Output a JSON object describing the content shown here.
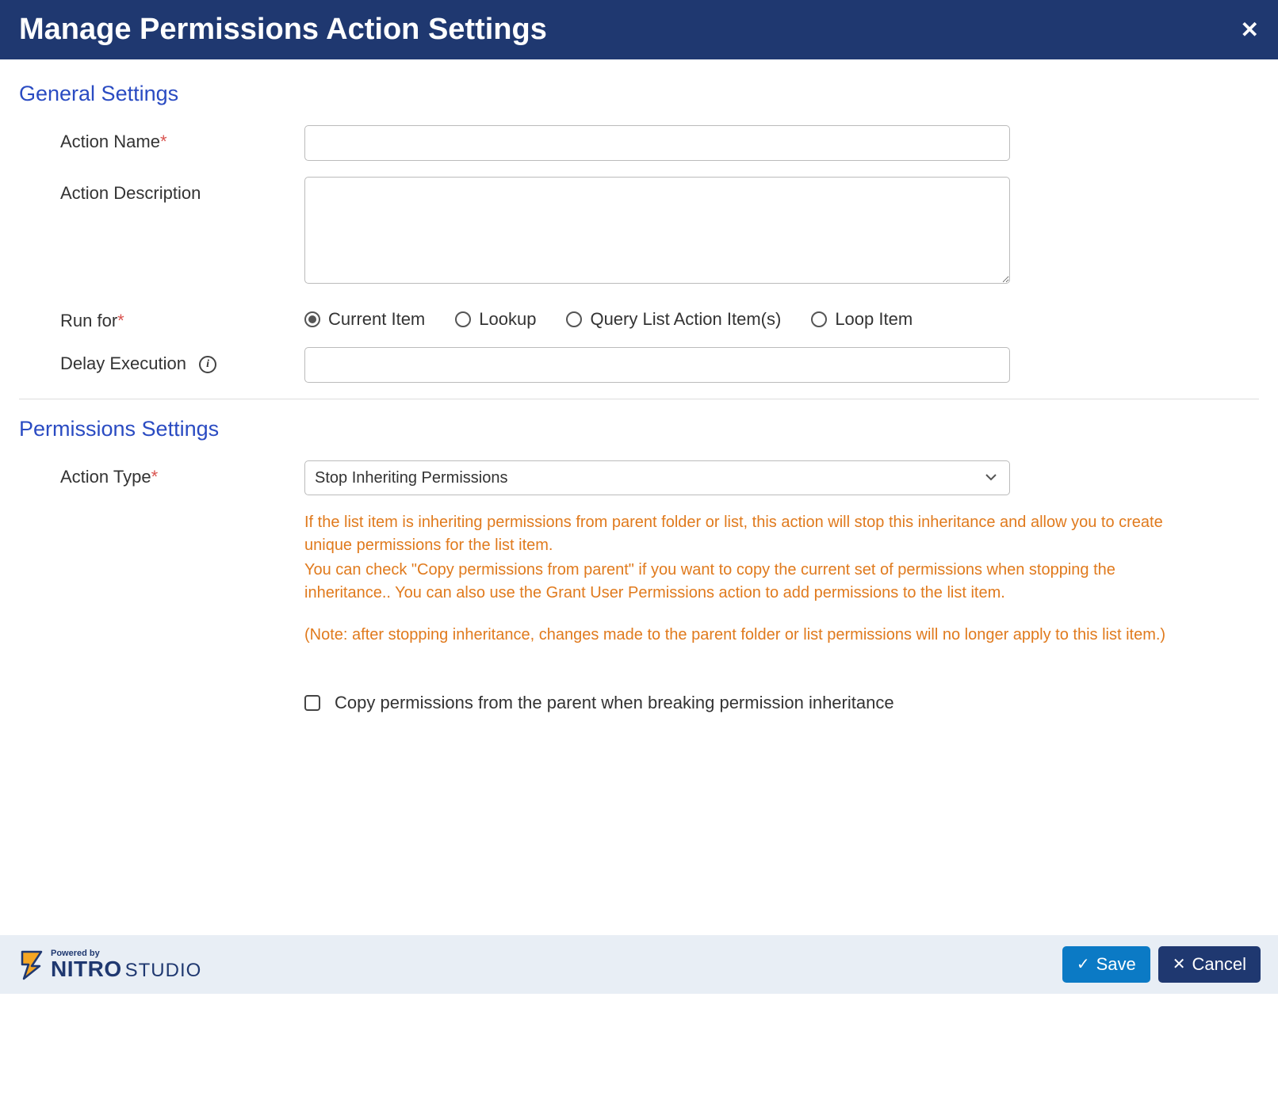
{
  "header": {
    "title": "Manage Permissions Action Settings"
  },
  "sections": {
    "general": {
      "title": "General Settings",
      "action_name_label": "Action Name",
      "action_name_value": "",
      "action_description_label": "Action Description",
      "action_description_value": "",
      "run_for_label": "Run for",
      "run_for_options": {
        "current": "Current Item",
        "lookup": "Lookup",
        "query": "Query List Action Item(s)",
        "loop": "Loop Item"
      },
      "run_for_selected": "current",
      "delay_label": "Delay Execution",
      "delay_value": ""
    },
    "permissions": {
      "title": "Permissions Settings",
      "action_type_label": "Action Type",
      "action_type_value": "Stop Inheriting Permissions",
      "help_1": "If the list item is inheriting permissions from parent folder or list, this action will stop this inheritance and allow you to create unique permissions for the list item.",
      "help_2": "You can check \"Copy permissions from parent\" if you want to copy the current set of permissions when stopping the inheritance.. You can also use the Grant User Permissions action to add permissions to the list item.",
      "help_3": "(Note: after stopping inheritance, changes made to the parent folder or list permissions will no longer apply to this list item.)",
      "copy_checkbox_label": "Copy permissions from the parent when breaking permission inheritance",
      "copy_checked": false
    }
  },
  "footer": {
    "powered_by": "Powered by",
    "brand_main": "NITRO",
    "brand_sub": "STUDIO",
    "save_label": "Save",
    "cancel_label": "Cancel"
  }
}
